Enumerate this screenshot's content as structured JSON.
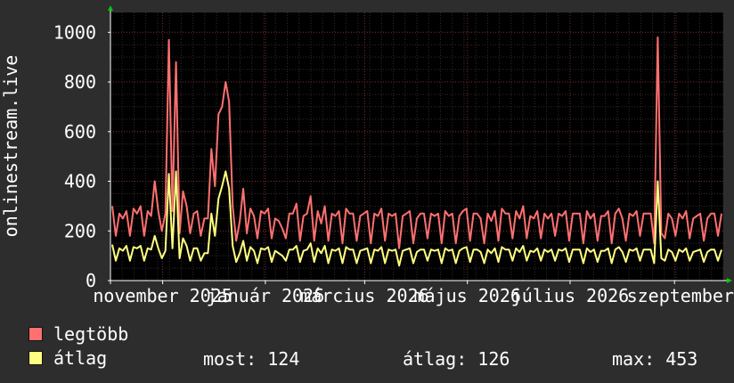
{
  "chart_data": {
    "type": "line",
    "ylabel": "onlinestream.live",
    "yticks": [
      "0",
      "200",
      "400",
      "600",
      "800",
      "1000"
    ],
    "ylim": [
      0,
      1080
    ],
    "xticks": [
      "november 2025",
      "január 2026",
      "március 2026",
      "május 2026",
      "július 2026",
      "szeptember"
    ],
    "x_start": "2025-10-01",
    "x_end": "2026-09-30",
    "xtick_dates": [
      "2025-11-01",
      "2026-01-01",
      "2026-03-01",
      "2026-05-01",
      "2026-07-01",
      "2026-09-01"
    ],
    "grid": true,
    "series": [
      {
        "name": "legtöbb",
        "color": "#ff7070",
        "values": [
          300,
          180,
          270,
          250,
          280,
          180,
          290,
          270,
          300,
          180,
          280,
          260,
          400,
          280,
          200,
          270,
          970,
          280,
          880,
          190,
          360,
          300,
          190,
          270,
          280,
          180,
          250,
          250,
          530,
          380,
          670,
          700,
          800,
          720,
          300,
          160,
          240,
          370,
          190,
          290,
          260,
          170,
          280,
          270,
          290,
          170,
          250,
          240,
          210,
          170,
          270,
          270,
          310,
          160,
          260,
          270,
          340,
          160,
          280,
          230,
          300,
          160,
          270,
          260,
          280,
          150,
          290,
          270,
          270,
          160,
          260,
          270,
          280,
          150,
          270,
          260,
          290,
          160,
          270,
          260,
          270,
          130,
          260,
          270,
          280,
          150,
          250,
          270,
          270,
          170,
          270,
          260,
          270,
          150,
          280,
          260,
          270,
          150,
          260,
          280,
          290,
          160,
          270,
          270,
          250,
          150,
          270,
          240,
          280,
          160,
          290,
          270,
          270,
          170,
          280,
          250,
          300,
          170,
          260,
          250,
          280,
          170,
          270,
          250,
          270,
          180,
          270,
          260,
          280,
          160,
          270,
          270,
          270,
          150,
          280,
          250,
          270,
          160,
          260,
          260,
          280,
          150,
          270,
          290,
          250,
          160,
          270,
          260,
          280,
          180,
          270,
          270,
          270,
          150,
          980,
          190,
          170,
          270,
          250,
          180,
          270,
          250,
          280,
          170,
          250,
          260,
          270,
          160,
          250,
          270,
          270,
          180,
          270
        ]
      },
      {
        "name": "átlag",
        "color": "#ffff80",
        "values": [
          145,
          80,
          130,
          120,
          140,
          80,
          135,
          130,
          140,
          80,
          130,
          125,
          180,
          130,
          90,
          120,
          430,
          130,
          440,
          90,
          170,
          140,
          80,
          130,
          130,
          80,
          110,
          110,
          270,
          180,
          330,
          380,
          440,
          370,
          140,
          75,
          110,
          160,
          80,
          135,
          120,
          70,
          130,
          125,
          135,
          75,
          120,
          110,
          100,
          80,
          125,
          125,
          140,
          75,
          120,
          125,
          150,
          75,
          130,
          110,
          140,
          70,
          125,
          120,
          130,
          70,
          135,
          125,
          125,
          70,
          120,
          125,
          130,
          70,
          125,
          120,
          135,
          70,
          125,
          120,
          125,
          60,
          120,
          125,
          130,
          70,
          115,
          125,
          125,
          80,
          125,
          120,
          125,
          70,
          130,
          120,
          125,
          70,
          120,
          130,
          135,
          75,
          125,
          125,
          115,
          70,
          125,
          110,
          130,
          75,
          135,
          125,
          125,
          80,
          130,
          115,
          140,
          80,
          120,
          115,
          130,
          80,
          125,
          115,
          125,
          80,
          125,
          120,
          130,
          75,
          125,
          125,
          125,
          70,
          130,
          115,
          125,
          75,
          120,
          120,
          130,
          70,
          125,
          135,
          115,
          75,
          125,
          120,
          130,
          80,
          125,
          125,
          125,
          70,
          400,
          90,
          80,
          125,
          115,
          80,
          125,
          115,
          130,
          80,
          115,
          120,
          125,
          75,
          115,
          125,
          125,
          80,
          124
        ]
      }
    ]
  },
  "legend": [
    {
      "label": "legtöbb",
      "color": "#ff7070"
    },
    {
      "label": "átlag",
      "color": "#ffff80"
    }
  ],
  "stats": {
    "most": "most: 124",
    "atlag": "átlag: 126",
    "max": "max: 453"
  }
}
